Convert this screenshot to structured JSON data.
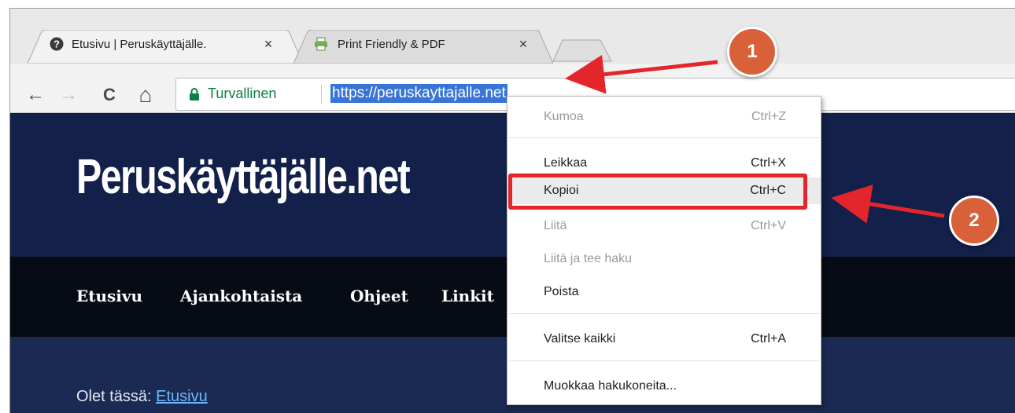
{
  "tabs": [
    {
      "title": "Etusivu | Peruskäyttäjälle.",
      "close": "×",
      "favicon": "help-circle-icon"
    },
    {
      "title": "Print Friendly & PDF",
      "close": "×",
      "favicon": "printer-icon"
    }
  ],
  "toolbar": {
    "back": "←",
    "forward": "→",
    "reload": "C",
    "home": "⌂",
    "security_label": "Turvallinen",
    "url": "https://peruskayttajalle.net"
  },
  "site": {
    "title": "Peruskäyttäjälle.net",
    "nav": [
      "Etusivu",
      "Ajankohtaista",
      "Ohjeet",
      "Linkit"
    ],
    "breadcrumb_prefix": "Olet tässä: ",
    "breadcrumb_link": "Etusivu"
  },
  "context_menu": {
    "items": [
      {
        "label": "Kumoa",
        "shortcut": "Ctrl+Z",
        "enabled": false
      },
      {
        "label": "Leikkaa",
        "shortcut": "Ctrl+X",
        "enabled": true
      },
      {
        "label": "Kopioi",
        "shortcut": "Ctrl+C",
        "enabled": true,
        "highlighted": true
      },
      {
        "label": "Liitä",
        "shortcut": "Ctrl+V",
        "enabled": false
      },
      {
        "label": "Liitä ja tee haku",
        "shortcut": "",
        "enabled": false
      },
      {
        "label": "Poista",
        "shortcut": "",
        "enabled": true
      },
      {
        "label": "Valitse kaikki",
        "shortcut": "Ctrl+A",
        "enabled": true
      },
      {
        "label": "Muokkaa hakukoneita...",
        "shortcut": "",
        "enabled": true
      }
    ]
  },
  "annotations": {
    "callout_1": "1",
    "callout_2": "2",
    "arrow_color": "#e3262c",
    "callout_color": "#d9613a"
  }
}
